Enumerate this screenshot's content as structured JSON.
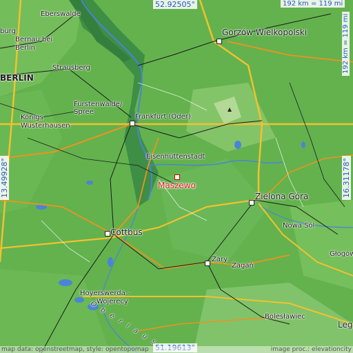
{
  "coords": {
    "top": "52.92505°",
    "bottom": "51.19613°",
    "left": "13.49928°",
    "right": "16.31178°",
    "scale_h": "192 km = 119 mi",
    "scale_v": "192 km = 119 mi"
  },
  "target": {
    "name": "Maszewo",
    "color": "#e0201d"
  },
  "places": {
    "eberswalde": "Eberswalde",
    "burg": "burg",
    "bernau": "Bernau bei",
    "berlin_small": "Berlin",
    "strausberg": "Strausberg",
    "berlin": "BERLIN",
    "fuerstenwalde1": "Fürstenwalde/",
    "fuerstenwalde2": "Spree",
    "koenigs1": "Königs",
    "koenigs2": "Wusterhausen",
    "frankfurt": "Frankfurt (Oder)",
    "gorzow": "Gorzów Wielkopolski",
    "eisenhuettenstadt": "Eisenhüttenstadt",
    "zielona_gora": "Zielona Góra",
    "nowa_sol": "Nowa Sól",
    "cottbus": "Cottbus",
    "zary": "Żary",
    "zagan": "Żagań",
    "glogow": "Głogów",
    "hoyerswerda": "Hoyerswerda -",
    "wojerecy": "Wojerecy",
    "oberlausitz": "O b e r l a u s",
    "boleslawiec": "Bolesławiec",
    "legnica": "Leg"
  },
  "attribution": {
    "left": "map data: openstreetmap, style: opentopomap",
    "right": "image proc.: elevationcity"
  },
  "colors": {
    "lowland": "#5fae4a",
    "river_valley": "#3f8f46",
    "hill": "#a8d28a",
    "road_major": "#f3c12f",
    "road_orange": "#f0921e",
    "water": "#4a84d8"
  }
}
